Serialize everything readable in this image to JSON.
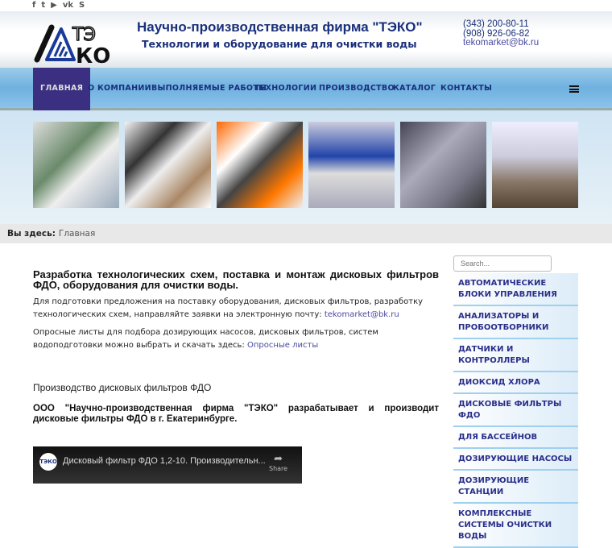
{
  "social": [
    {
      "icon": "facebook-icon",
      "glyph": "f"
    },
    {
      "icon": "twitter-icon",
      "glyph": "t"
    },
    {
      "icon": "youtube-icon",
      "glyph": "▶"
    },
    {
      "icon": "vk-icon",
      "glyph": "vk"
    },
    {
      "icon": "skype-icon",
      "glyph": "S"
    }
  ],
  "header": {
    "logo_text": "ТЭКО",
    "title": "Научно-производственная фирма \"ТЭКО\"",
    "subtitle": "Технологии и оборудование для очистки воды",
    "phone1": "(343) 200-80-11",
    "phone2": "(908) 926-06-82",
    "email": "tekomarket@bk.ru"
  },
  "nav": [
    "ГЛАВНАЯ",
    "О КОМПАНИИ",
    "ВЫПОЛНЯЕМЫЕ РАБОТЫ",
    "ТЕХНОЛОГИИ",
    "ПРОИЗВОДСТВО",
    "КАТАЛОГ",
    "КОНТАКТЫ"
  ],
  "breadcrumb": {
    "label": "Вы здесь:",
    "current": "Главная"
  },
  "main": {
    "heading": "Разработка технологических схем, поставка и монтаж дисковых фильтров ФДО, оборудования для очистки воды.",
    "p1": "Для подготовки предложения на поставку оборудования, дисковых фильтров, разработку технологических схем,  направляйте заявки на электронную почту: ",
    "p1_link": "tekomarket@bk.ru",
    "p2": "Опросные листы для подбора дозирующих насосов, дисковых фильтров, систем водоподготовки можно выбрать и скачать здесь: ",
    "p2_link": "Опросные листы",
    "h2": "Производство дисковых фильтров ФДО",
    "bold": "ООО \"Научно-производственная фирма \"ТЭКО\" разрабатывает и производит дисковые фильтры ФДО в г. Екатеринбурге."
  },
  "video": {
    "title": "Дисковый фильтр ФДО 1,2-10. Производительн...",
    "share": "Share",
    "channel_logo": "ТЭКО"
  },
  "search": {
    "placeholder": "Search..."
  },
  "sidebar": [
    "АВТОМАТИЧЕСКИЕ БЛОКИ УПРАВЛЕНИЯ",
    "АНАЛИЗАТОРЫ И ПРОБООТБОРНИКИ",
    "ДАТЧИКИ И КОНТРОЛЛЕРЫ",
    "ДИОКСИД ХЛОРА",
    "ДИСКОВЫЕ ФИЛЬТРЫ ФДО",
    "ДЛЯ БАССЕЙНОВ",
    "ДОЗИРУЮЩИЕ НАСОСЫ",
    "ДОЗИРУЮЩИЕ СТАНЦИИ",
    "КОМПЛЕКСНЫЕ СИСТЕМЫ ОЧИСТКИ ВОДЫ"
  ],
  "colors": {
    "brand": "#1a2f7a",
    "active_nav": "#3a2f80",
    "link": "#4a4aa0"
  }
}
